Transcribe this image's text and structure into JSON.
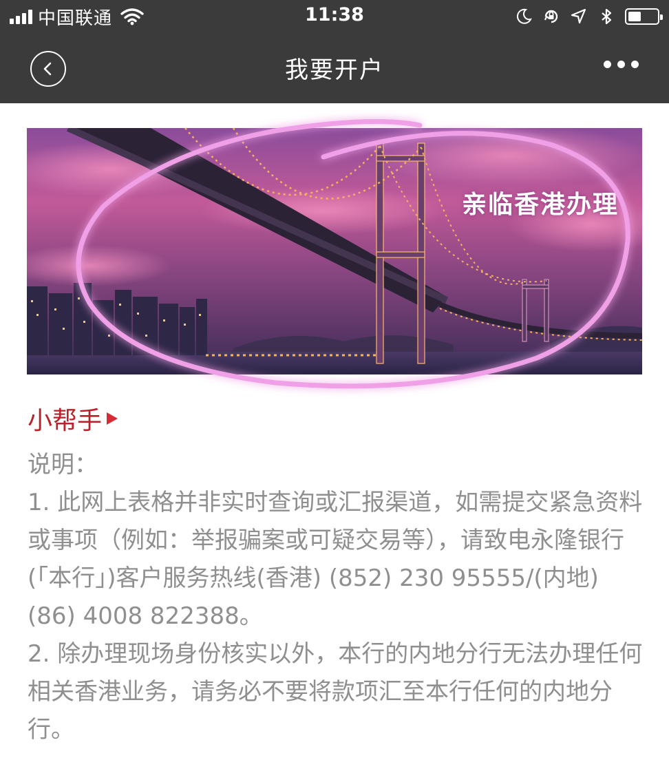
{
  "status_bar": {
    "carrier": "中国联通",
    "time": "11:38",
    "battery_level": 0.45,
    "icons": [
      "signal-icon",
      "wifi-icon",
      "moon-icon",
      "orientation-lock-icon",
      "location-icon",
      "bluetooth-icon",
      "battery-icon"
    ]
  },
  "nav": {
    "title": "我要开户",
    "back_icon": "back-arrow-icon",
    "more_icon": "more-dots-icon"
  },
  "banner": {
    "caption": "亲临香港办理",
    "highlight_color": "#f0a0e6"
  },
  "helper": {
    "label": "小帮手",
    "color": "#b7222b",
    "arrow_icon": "play-arrow-icon"
  },
  "notes": {
    "heading": "说明：",
    "item1": "1. 此网上表格并非实时查询或汇报渠道，如需提交紧急资料或事项（例如：举报骗案或可疑交易等），请致电永隆银行(「本行」)客户服务热线(香港) (852) 230 95555/(内地) (86) 4008 822388。",
    "item2": "2. 除办理现场身份核实以外，本行的内地分行无法办理任何相关香港业务，请务必不要将款项汇至本行任何的内地分行。"
  }
}
